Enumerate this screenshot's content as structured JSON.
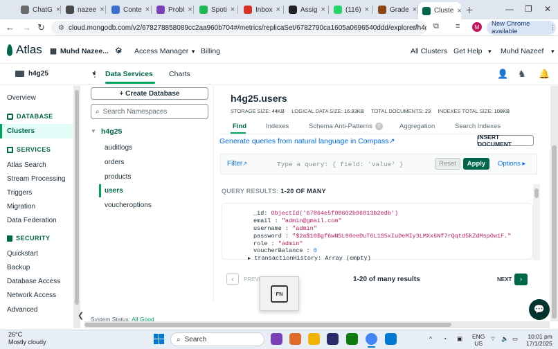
{
  "browser": {
    "tabs": [
      {
        "label": "ChatG",
        "color": "#6b6b6b"
      },
      {
        "label": "nazee",
        "color": "#4a4a4a"
      },
      {
        "label": "Conte",
        "color": "#3b6fd1"
      },
      {
        "label": "Probl",
        "color": "#7b3fb8"
      },
      {
        "label": "Spoti",
        "color": "#1db954"
      },
      {
        "label": "Inbox",
        "color": "#d93025"
      },
      {
        "label": "Assig",
        "color": "#222222"
      },
      {
        "label": "(116)",
        "color": "#25d366"
      },
      {
        "label": "Grade",
        "color": "#8b4513"
      },
      {
        "label": "Cluste",
        "color": "#00684a"
      }
    ],
    "url": "cloud.mongodb.com/v2/678278858089cc2aa960b704#/metrics/replicaSet/6782790ca1605a0696540ddd/explorer/h4g25/us...",
    "avatar_letter": "M",
    "new_chrome_label": "New Chrome available"
  },
  "atlas_header": {
    "logo_text": "Atlas",
    "org_name": "Muhd Nazee...",
    "access_manager": "Access Manager",
    "billing": "Billing",
    "all_clusters": "All Clusters",
    "get_help": "Get Help",
    "user": "Muhd Nazeef"
  },
  "project_bar": {
    "project_name": "h4g25",
    "tab_data_services": "Data Services",
    "tab_charts": "Charts"
  },
  "left_nav": {
    "overview": "Overview",
    "database_header": "DATABASE",
    "clusters": "Clusters",
    "services_header": "SERVICES",
    "services": [
      "Atlas Search",
      "Stream Processing",
      "Triggers",
      "Migration",
      "Data Federation"
    ],
    "security_header": "SECURITY",
    "security": [
      "Quickstart",
      "Backup",
      "Database Access",
      "Network Access",
      "Advanced"
    ]
  },
  "namespaces": {
    "create_db_label": "+ Create Database",
    "search_placeholder": "Search Namespaces",
    "database": "h4g25",
    "collections": [
      "auditlogs",
      "orders",
      "products",
      "users",
      "voucheroptions"
    ]
  },
  "collection": {
    "title": "h4g25.users",
    "storage_size_label": "STORAGE SIZE:",
    "storage_size": "44KB",
    "logical_size_label": "LOGICAL DATA SIZE:",
    "logical_size": "16.93KB",
    "total_docs_label": "TOTAL DOCUMENTS:",
    "total_docs": "23",
    "index_size_label": "INDEXES TOTAL SIZE:",
    "index_size": "108KB",
    "tabs": [
      "Find",
      "Indexes",
      "Schema Anti-Patterns",
      "Aggregation",
      "Search Indexes"
    ],
    "anti_pattern_count": "0",
    "gen_queries_link": "Generate queries from natural language in Compass",
    "insert_doc": "INSERT DOCUMENT",
    "filter_label": "Filter",
    "query_placeholder": "Type a query: { field: 'value' }",
    "reset": "Reset",
    "apply": "Apply",
    "options": "Options ▸",
    "query_results_label": "QUERY RESULTS:",
    "query_results_range": "1-20 OF MANY",
    "document": {
      "id_key": "_id",
      "id_val": "ObjectId('67864e5f08602b96813b2edb')",
      "email_key": "email",
      "email_val": "\"admin@gmail.com\"",
      "username_key": "username",
      "username_val": "\"admin\"",
      "password_key": "password",
      "password_val": "\"$2a$10$gf6wNSL90oeDuT6L1S5xIuDeMIy3LMXx6Nf7rQqtd5kZdMspOw1F.\"",
      "role_key": "role",
      "role_val": "\"admin\"",
      "voucher_key": "voucherBalance",
      "voucher_val": "0",
      "tx_key": "transactionHistory",
      "tx_val": "Array (empty)"
    },
    "previous": "PREVIOUS",
    "page_summary": "1-20 of many results",
    "next": "NEXT",
    "fn_key_label": "FN"
  },
  "status": {
    "label": "System Status:",
    "value": "All Good"
  },
  "taskbar": {
    "temperature": "26°C",
    "condition": "Mostly cloudy",
    "search": "Search",
    "lang_line1": "ENG",
    "lang_line2": "US",
    "time": "10:01 pm",
    "date": "17/1/2025"
  }
}
